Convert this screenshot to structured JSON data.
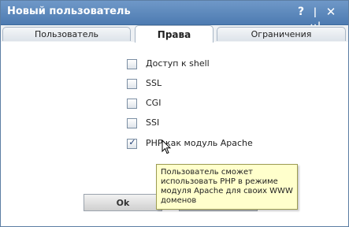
{
  "window": {
    "title": "Новый пользователь",
    "help_icon": "?",
    "resize_icon": "|↔|",
    "close_icon": "✕"
  },
  "tabs": [
    {
      "label": "Пользователь",
      "active": false
    },
    {
      "label": "Права",
      "active": true
    },
    {
      "label": "Ограничения",
      "active": false
    }
  ],
  "options": [
    {
      "label": "Доступ к shell",
      "checked": false
    },
    {
      "label": "SSL",
      "checked": false
    },
    {
      "label": "CGI",
      "checked": false
    },
    {
      "label": "SSI",
      "checked": false
    },
    {
      "label": "PHP как модуль Apache",
      "checked": true
    }
  ],
  "tooltip": {
    "text": "Пользователь сможет использовать PHP в режиме модуля Apache для своих WWW доменов"
  },
  "buttons": {
    "ok_label": "Ok",
    "cancel_label": ""
  },
  "colors": {
    "titlebar": "#5b87bb",
    "tooltip_bg": "#ffffcc"
  }
}
